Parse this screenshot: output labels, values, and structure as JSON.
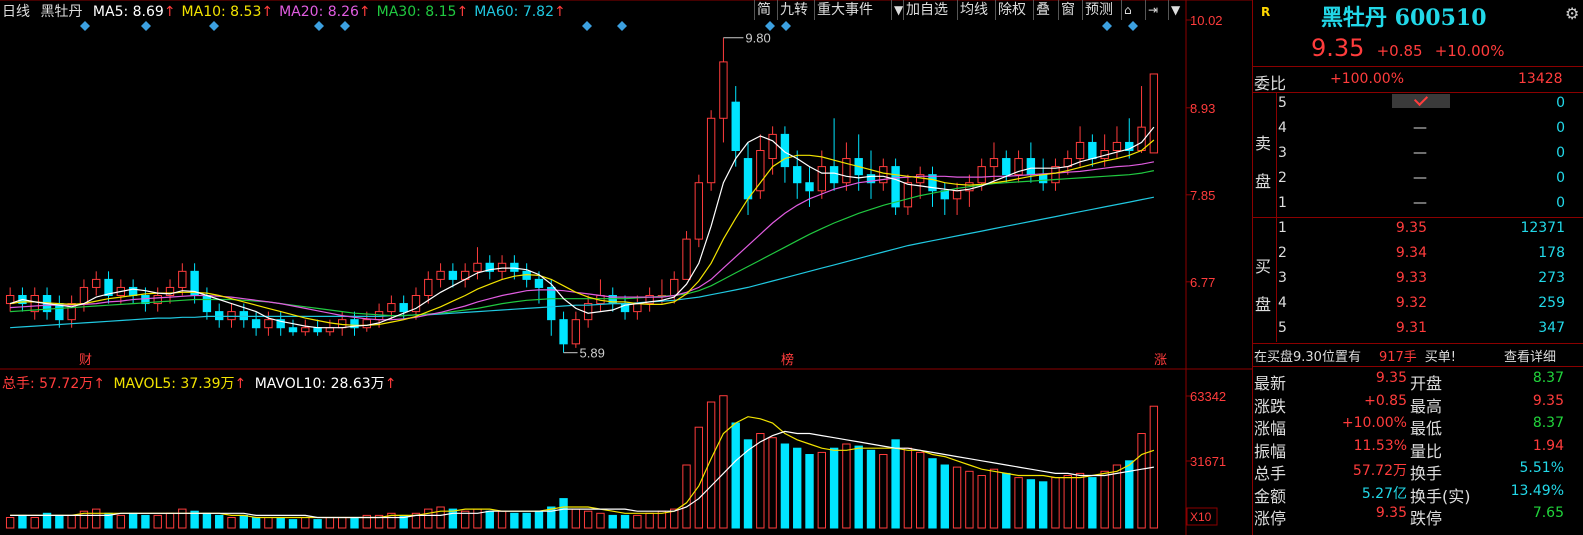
{
  "header": {
    "period": "日线",
    "name": "黑牡丹",
    "ma": [
      {
        "label": "MA5: 8.69",
        "color": "#ffffff"
      },
      {
        "label": "MA10: 8.53",
        "color": "#f2e300"
      },
      {
        "label": "MA20: 8.26",
        "color": "#e05ce0"
      },
      {
        "label": "MA30: 8.15",
        "color": "#20c840"
      },
      {
        "label": "MA60: 7.82",
        "color": "#20c8e0"
      }
    ]
  },
  "toolbar": [
    "简",
    "九转",
    "重大事件",
    "加自选",
    "均线",
    "除权",
    "叠",
    "窗",
    "预测"
  ],
  "axis": {
    "price_ticks": [
      "10.02",
      "8.93",
      "7.85",
      "6.77"
    ],
    "vol_ticks": [
      "63342",
      "31671"
    ],
    "vol_unit": "X10",
    "annotations": {
      "high": "9.80",
      "low": "5.89"
    },
    "markers": [
      "财",
      "榜",
      "涨"
    ]
  },
  "volume_header": {
    "total": "总手: 57.72万",
    "mavol5": "MAVOL5: 37.39万",
    "mavol10": "MAVOL10: 28.63万"
  },
  "quote": {
    "badge": "R",
    "title": "黑牡丹 600510",
    "price": "9.35",
    "change": "+0.85",
    "change_pct": "+10.00%",
    "weibi_label": "委比",
    "weibi": "+100.00%",
    "weicha": "13428",
    "sell_label": [
      "卖",
      "盘"
    ],
    "buy_label": [
      "买",
      "盘"
    ],
    "sell": [
      {
        "level": "5",
        "price": "",
        "vol": "0"
      },
      {
        "level": "4",
        "price": "—",
        "vol": "0"
      },
      {
        "level": "3",
        "price": "—",
        "vol": "0"
      },
      {
        "level": "2",
        "price": "—",
        "vol": "0"
      },
      {
        "level": "1",
        "price": "—",
        "vol": "0"
      }
    ],
    "buy": [
      {
        "level": "1",
        "price": "9.35",
        "vol": "12371"
      },
      {
        "level": "2",
        "price": "9.34",
        "vol": "178"
      },
      {
        "level": "3",
        "price": "9.33",
        "vol": "273"
      },
      {
        "level": "4",
        "price": "9.32",
        "vol": "259"
      },
      {
        "level": "5",
        "price": "9.31",
        "vol": "347"
      }
    ],
    "notice": {
      "pre": "在买盘9.30位置有",
      "qty": "917手",
      "post": "买单!",
      "link": "查看详细"
    },
    "stats": [
      {
        "l1": "最新",
        "v1": "9.35",
        "c1": "red",
        "l2": "开盘",
        "v2": "8.37",
        "c2": "green"
      },
      {
        "l1": "涨跌",
        "v1": "+0.85",
        "c1": "red",
        "l2": "最高",
        "v2": "9.35",
        "c2": "red"
      },
      {
        "l1": "涨幅",
        "v1": "+10.00%",
        "c1": "red",
        "l2": "最低",
        "v2": "8.37",
        "c2": "green"
      },
      {
        "l1": "振幅",
        "v1": "11.53%",
        "c1": "red",
        "l2": "量比",
        "v2": "1.94",
        "c2": "red"
      },
      {
        "l1": "总手",
        "v1": "57.72万",
        "c1": "red",
        "l2": "换手",
        "v2": "5.51%",
        "c2": "cyan"
      },
      {
        "l1": "金额",
        "v1": "5.27亿",
        "c1": "cyan",
        "l2": "换手(实)",
        "v2": "13.49%",
        "c2": "cyan"
      },
      {
        "l1": "涨停",
        "v1": "9.35",
        "c1": "red",
        "l2": "跌停",
        "v2": "7.65",
        "c2": "green"
      }
    ]
  },
  "colors": {
    "up": "#ff3c3c",
    "down": "#00e5ff",
    "grid": "#8b0000",
    "ma5": "#ffffff",
    "ma10": "#f2e300",
    "ma20": "#e05ce0",
    "ma30": "#20c840",
    "ma60": "#20c8e0"
  },
  "chart_data": {
    "type": "candlestick",
    "price_axis": [
      5.7,
      10.02
    ],
    "candles": [
      [
        6.5,
        6.6,
        6.7,
        6.4
      ],
      [
        6.6,
        6.5,
        6.7,
        6.4
      ],
      [
        6.4,
        6.6,
        6.7,
        6.3
      ],
      [
        6.6,
        6.4,
        6.7,
        6.3
      ],
      [
        6.5,
        6.3,
        6.6,
        6.2
      ],
      [
        6.3,
        6.5,
        6.6,
        6.2
      ],
      [
        6.5,
        6.7,
        6.8,
        6.4
      ],
      [
        6.7,
        6.8,
        6.9,
        6.6
      ],
      [
        6.8,
        6.6,
        6.9,
        6.5
      ],
      [
        6.6,
        6.7,
        6.8,
        6.5
      ],
      [
        6.7,
        6.6,
        6.8,
        6.5
      ],
      [
        6.6,
        6.5,
        6.7,
        6.4
      ],
      [
        6.5,
        6.6,
        6.7,
        6.4
      ],
      [
        6.6,
        6.7,
        6.8,
        6.5
      ],
      [
        6.7,
        6.9,
        7.0,
        6.6
      ],
      [
        6.9,
        6.6,
        7.0,
        6.5
      ],
      [
        6.6,
        6.4,
        6.7,
        6.3
      ],
      [
        6.4,
        6.3,
        6.5,
        6.2
      ],
      [
        6.3,
        6.4,
        6.5,
        6.2
      ],
      [
        6.4,
        6.3,
        6.5,
        6.2
      ],
      [
        6.3,
        6.2,
        6.4,
        6.1
      ],
      [
        6.2,
        6.3,
        6.4,
        6.1
      ],
      [
        6.3,
        6.2,
        6.4,
        6.1
      ],
      [
        6.2,
        6.15,
        6.3,
        6.1
      ],
      [
        6.15,
        6.2,
        6.3,
        6.1
      ],
      [
        6.2,
        6.15,
        6.3,
        6.1
      ],
      [
        6.15,
        6.2,
        6.3,
        6.1
      ],
      [
        6.2,
        6.3,
        6.4,
        6.1
      ],
      [
        6.3,
        6.2,
        6.4,
        6.1
      ],
      [
        6.2,
        6.3,
        6.4,
        6.15
      ],
      [
        6.3,
        6.4,
        6.5,
        6.2
      ],
      [
        6.4,
        6.5,
        6.6,
        6.3
      ],
      [
        6.5,
        6.4,
        6.6,
        6.3
      ],
      [
        6.4,
        6.6,
        6.7,
        6.3
      ],
      [
        6.6,
        6.8,
        6.9,
        6.5
      ],
      [
        6.8,
        6.9,
        7.0,
        6.7
      ],
      [
        6.9,
        6.8,
        7.0,
        6.7
      ],
      [
        6.8,
        6.9,
        7.0,
        6.7
      ],
      [
        6.9,
        7.0,
        7.2,
        6.8
      ],
      [
        7.0,
        6.9,
        7.1,
        6.8
      ],
      [
        6.9,
        7.0,
        7.1,
        6.8
      ],
      [
        7.0,
        6.9,
        7.1,
        6.8
      ],
      [
        6.9,
        6.8,
        7.0,
        6.7
      ],
      [
        6.8,
        6.7,
        6.9,
        6.5
      ],
      [
        6.7,
        6.3,
        6.8,
        6.1
      ],
      [
        6.3,
        6.0,
        6.4,
        5.89
      ],
      [
        6.0,
        6.3,
        6.4,
        5.95
      ],
      [
        6.3,
        6.5,
        6.6,
        6.2
      ],
      [
        6.5,
        6.6,
        6.8,
        6.4
      ],
      [
        6.6,
        6.5,
        6.7,
        6.4
      ],
      [
        6.5,
        6.4,
        6.6,
        6.3
      ],
      [
        6.4,
        6.5,
        6.6,
        6.3
      ],
      [
        6.5,
        6.6,
        6.7,
        6.4
      ],
      [
        6.6,
        6.6,
        6.8,
        6.5
      ],
      [
        6.6,
        6.8,
        6.9,
        6.5
      ],
      [
        6.8,
        7.3,
        7.4,
        6.8
      ],
      [
        7.3,
        8.0,
        8.1,
        7.2
      ],
      [
        8.0,
        8.8,
        8.9,
        7.9
      ],
      [
        8.8,
        9.5,
        9.8,
        8.5
      ],
      [
        9.0,
        8.4,
        9.2,
        8.2
      ],
      [
        8.3,
        7.8,
        8.5,
        7.6
      ],
      [
        7.9,
        8.4,
        8.6,
        7.8
      ],
      [
        8.3,
        8.6,
        8.7,
        8.1
      ],
      [
        8.6,
        8.2,
        8.7,
        8.0
      ],
      [
        8.2,
        8.0,
        8.4,
        7.8
      ],
      [
        8.0,
        7.9,
        8.2,
        7.7
      ],
      [
        7.9,
        8.2,
        8.4,
        7.8
      ],
      [
        8.2,
        8.0,
        8.8,
        7.9
      ],
      [
        8.0,
        8.3,
        8.5,
        7.9
      ],
      [
        8.3,
        8.1,
        8.6,
        7.9
      ],
      [
        8.1,
        8.0,
        8.4,
        7.8
      ],
      [
        8.0,
        8.2,
        8.3,
        7.9
      ],
      [
        8.2,
        7.7,
        8.3,
        7.6
      ],
      [
        7.7,
        8.0,
        8.1,
        7.6
      ],
      [
        8.0,
        8.1,
        8.2,
        7.8
      ],
      [
        8.1,
        7.9,
        8.2,
        7.7
      ],
      [
        7.9,
        7.8,
        8.0,
        7.6
      ],
      [
        7.8,
        7.9,
        8.0,
        7.6
      ],
      [
        7.9,
        8.0,
        8.1,
        7.7
      ],
      [
        8.0,
        8.2,
        8.3,
        7.9
      ],
      [
        8.2,
        8.3,
        8.5,
        8.0
      ],
      [
        8.3,
        8.1,
        8.4,
        8.0
      ],
      [
        8.1,
        8.3,
        8.4,
        8.0
      ],
      [
        8.3,
        8.1,
        8.5,
        8.0
      ],
      [
        8.1,
        8.0,
        8.3,
        7.9
      ],
      [
        8.0,
        8.2,
        8.3,
        7.9
      ],
      [
        8.2,
        8.3,
        8.4,
        8.1
      ],
      [
        8.3,
        8.5,
        8.7,
        8.2
      ],
      [
        8.5,
        8.3,
        8.6,
        8.2
      ],
      [
        8.3,
        8.4,
        8.6,
        8.2
      ],
      [
        8.4,
        8.5,
        8.7,
        8.3
      ],
      [
        8.5,
        8.4,
        8.8,
        8.3
      ],
      [
        8.4,
        8.69,
        9.2,
        8.37
      ],
      [
        8.37,
        9.35,
        9.35,
        8.37
      ]
    ],
    "volume": [
      5,
      6,
      5,
      7,
      6,
      6,
      8,
      9,
      7,
      6,
      7,
      6,
      6,
      7,
      9,
      8,
      7,
      6,
      5,
      6,
      5,
      5,
      5,
      4,
      5,
      4,
      5,
      5,
      5,
      6,
      6,
      7,
      6,
      7,
      9,
      10,
      9,
      8,
      9,
      8,
      8,
      7,
      7,
      8,
      10,
      14,
      9,
      8,
      7,
      6,
      6,
      6,
      7,
      8,
      9,
      30,
      48,
      60,
      63,
      50,
      42,
      45,
      43,
      40,
      38,
      35,
      36,
      38,
      40,
      39,
      37,
      35,
      42,
      38,
      36,
      33,
      30,
      29,
      27,
      25,
      28,
      26,
      24,
      23,
      22,
      24,
      25,
      26,
      24,
      27,
      30,
      32,
      45,
      58
    ],
    "ma5": [
      6.5,
      6.55,
      6.52,
      6.5,
      6.48,
      6.46,
      6.5,
      6.58,
      6.62,
      6.65,
      6.68,
      6.66,
      6.63,
      6.62,
      6.66,
      6.65,
      6.6,
      6.55,
      6.5,
      6.45,
      6.4,
      6.32,
      6.28,
      6.25,
      6.22,
      6.2,
      6.2,
      6.2,
      6.22,
      6.23,
      6.26,
      6.32,
      6.38,
      6.44,
      6.54,
      6.64,
      6.72,
      6.8,
      6.88,
      6.92,
      6.94,
      6.94,
      6.92,
      6.86,
      6.74,
      6.56,
      6.44,
      6.38,
      6.4,
      6.42,
      6.48,
      6.5,
      6.52,
      6.54,
      6.58,
      6.74,
      7.0,
      7.46,
      8.0,
      8.3,
      8.5,
      8.58,
      8.52,
      8.38,
      8.3,
      8.2,
      8.12,
      8.12,
      8.08,
      8.06,
      8.08,
      8.08,
      8.04,
      7.98,
      7.96,
      7.94,
      7.92,
      7.9,
      7.92,
      7.96,
      8.02,
      8.08,
      8.14,
      8.18,
      8.18,
      8.18,
      8.2,
      8.26,
      8.3,
      8.34,
      8.38,
      8.42,
      8.5,
      8.69
    ],
    "ma10": [
      6.5,
      6.52,
      6.52,
      6.51,
      6.5,
      6.49,
      6.5,
      6.53,
      6.56,
      6.58,
      6.6,
      6.62,
      6.63,
      6.63,
      6.64,
      6.64,
      6.63,
      6.6,
      6.56,
      6.52,
      6.48,
      6.44,
      6.4,
      6.36,
      6.32,
      6.29,
      6.26,
      6.24,
      6.23,
      6.23,
      6.24,
      6.27,
      6.3,
      6.34,
      6.4,
      6.46,
      6.53,
      6.6,
      6.68,
      6.74,
      6.8,
      6.84,
      6.86,
      6.85,
      6.8,
      6.72,
      6.64,
      6.58,
      6.54,
      6.52,
      6.52,
      6.5,
      6.49,
      6.49,
      6.52,
      6.62,
      6.78,
      7.0,
      7.3,
      7.56,
      7.8,
      8.0,
      8.2,
      8.3,
      8.34,
      8.34,
      8.32,
      8.28,
      8.24,
      8.2,
      8.16,
      8.12,
      8.1,
      8.08,
      8.06,
      8.04,
      8.0,
      7.98,
      7.97,
      7.98,
      8.0,
      8.02,
      8.05,
      8.08,
      8.1,
      8.12,
      8.15,
      8.19,
      8.23,
      8.27,
      8.3,
      8.34,
      8.4,
      8.53
    ],
    "ma20": [
      6.45,
      6.46,
      6.47,
      6.48,
      6.48,
      6.48,
      6.49,
      6.5,
      6.52,
      6.53,
      6.55,
      6.56,
      6.57,
      6.58,
      6.59,
      6.6,
      6.6,
      6.59,
      6.58,
      6.56,
      6.54,
      6.52,
      6.5,
      6.47,
      6.44,
      6.41,
      6.38,
      6.35,
      6.33,
      6.31,
      6.3,
      6.3,
      6.31,
      6.33,
      6.36,
      6.39,
      6.43,
      6.47,
      6.52,
      6.56,
      6.6,
      6.63,
      6.66,
      6.67,
      6.67,
      6.66,
      6.64,
      6.62,
      6.6,
      6.58,
      6.58,
      6.58,
      6.58,
      6.58,
      6.6,
      6.64,
      6.7,
      6.8,
      6.94,
      7.08,
      7.22,
      7.36,
      7.5,
      7.62,
      7.72,
      7.8,
      7.86,
      7.92,
      7.96,
      8.0,
      8.02,
      8.04,
      8.06,
      8.07,
      8.08,
      8.08,
      8.08,
      8.07,
      8.07,
      8.07,
      8.08,
      8.08,
      8.09,
      8.1,
      8.11,
      8.12,
      8.13,
      8.14,
      8.16,
      8.18,
      8.2,
      8.21,
      8.23,
      8.26
    ],
    "ma30": [
      6.4,
      6.41,
      6.42,
      6.43,
      6.44,
      6.45,
      6.46,
      6.47,
      6.48,
      6.49,
      6.5,
      6.51,
      6.52,
      6.53,
      6.54,
      6.55,
      6.55,
      6.55,
      6.55,
      6.54,
      6.53,
      6.52,
      6.5,
      6.48,
      6.46,
      6.44,
      6.42,
      6.4,
      6.38,
      6.37,
      6.36,
      6.35,
      6.35,
      6.36,
      6.37,
      6.38,
      6.4,
      6.42,
      6.44,
      6.47,
      6.5,
      6.52,
      6.54,
      6.55,
      6.56,
      6.56,
      6.56,
      6.56,
      6.56,
      6.56,
      6.56,
      6.57,
      6.58,
      6.59,
      6.6,
      6.62,
      6.66,
      6.72,
      6.8,
      6.88,
      6.96,
      7.04,
      7.12,
      7.2,
      7.28,
      7.36,
      7.43,
      7.5,
      7.56,
      7.62,
      7.67,
      7.72,
      7.76,
      7.8,
      7.84,
      7.87,
      7.9,
      7.93,
      7.95,
      7.97,
      7.99,
      8.0,
      8.01,
      8.02,
      8.03,
      8.04,
      8.05,
      8.06,
      8.07,
      8.08,
      8.09,
      8.1,
      8.12,
      8.15
    ],
    "ma60": [
      6.2,
      6.21,
      6.22,
      6.23,
      6.24,
      6.25,
      6.26,
      6.27,
      6.28,
      6.29,
      6.3,
      6.31,
      6.32,
      6.32,
      6.33,
      6.33,
      6.34,
      6.34,
      6.34,
      6.34,
      6.34,
      6.34,
      6.34,
      6.34,
      6.34,
      6.34,
      6.34,
      6.34,
      6.34,
      6.34,
      6.34,
      6.35,
      6.35,
      6.36,
      6.36,
      6.37,
      6.38,
      6.39,
      6.4,
      6.41,
      6.42,
      6.43,
      6.44,
      6.45,
      6.46,
      6.47,
      6.48,
      6.48,
      6.49,
      6.5,
      6.5,
      6.51,
      6.52,
      6.53,
      6.54,
      6.56,
      6.58,
      6.61,
      6.64,
      6.67,
      6.7,
      6.74,
      6.78,
      6.82,
      6.86,
      6.9,
      6.94,
      6.98,
      7.02,
      7.06,
      7.1,
      7.14,
      7.18,
      7.22,
      7.25,
      7.28,
      7.31,
      7.34,
      7.37,
      7.4,
      7.43,
      7.46,
      7.49,
      7.52,
      7.55,
      7.58,
      7.61,
      7.64,
      7.67,
      7.7,
      7.73,
      7.76,
      7.79,
      7.82
    ],
    "mavol5": [
      6,
      6,
      6,
      6,
      6,
      6,
      7,
      7,
      7,
      7,
      7,
      7,
      7,
      7,
      7,
      7,
      7,
      7,
      6,
      6,
      5,
      5,
      5,
      5,
      5,
      5,
      5,
      5,
      5,
      5,
      5,
      6,
      6,
      6,
      7,
      8,
      8,
      9,
      9,
      9,
      8,
      8,
      8,
      8,
      9,
      10,
      10,
      10,
      9,
      8,
      7,
      7,
      7,
      7,
      8,
      12,
      20,
      33,
      45,
      50,
      53,
      52,
      50,
      45,
      42,
      40,
      38,
      37,
      37,
      38,
      38,
      38,
      38,
      37,
      37,
      35,
      34,
      32,
      30,
      28,
      27,
      26,
      25,
      25,
      25,
      24,
      24,
      24,
      25,
      26,
      27,
      30,
      35,
      37
    ],
    "mavol10": [
      6,
      6,
      6,
      6,
      6,
      6,
      6,
      6,
      6,
      7,
      7,
      7,
      7,
      7,
      7,
      7,
      7,
      7,
      7,
      7,
      6,
      6,
      6,
      6,
      6,
      5,
      5,
      5,
      5,
      5,
      5,
      5,
      5,
      6,
      6,
      6,
      7,
      7,
      7,
      8,
      8,
      8,
      8,
      8,
      8,
      9,
      9,
      9,
      9,
      9,
      9,
      8,
      8,
      8,
      8,
      10,
      14,
      20,
      26,
      32,
      37,
      41,
      44,
      46,
      45,
      45,
      44,
      43,
      42,
      41,
      40,
      39,
      38,
      38,
      37,
      36,
      35,
      34,
      33,
      32,
      31,
      30,
      29,
      28,
      27,
      26,
      26,
      25,
      25,
      25,
      26,
      27,
      28,
      29
    ]
  }
}
